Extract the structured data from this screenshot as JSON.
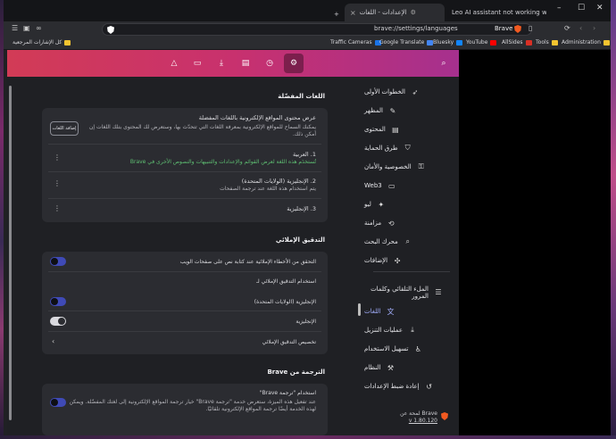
{
  "tabs": {
    "new_tab": "+",
    "active_title": "الإعدادات - اللغات",
    "other_title": "Leo AI assistant not working when B",
    "close": "×",
    "minimize": "–",
    "maximize": "☐",
    "window_close": "✕"
  },
  "toolbar": {
    "url": "brave://settings/languages",
    "brand": "Brave"
  },
  "bookmarks": [
    {
      "label": "Traffic Cameras",
      "color": "#1a73e8"
    },
    {
      "label": "Google Translate",
      "color": "#4285f4"
    },
    {
      "label": "Bluesky",
      "color": "#1185fe"
    },
    {
      "label": "YouTube",
      "color": "#ff0000"
    },
    {
      "label": "AllSides",
      "color": "#d93025"
    },
    {
      "label": "Tools",
      "color": "#f4c430"
    },
    {
      "label": "Administration",
      "color": "#f4c430"
    },
    {
      "label": "كل الإشارات المرجعية",
      "color": "#f4c430"
    }
  ],
  "sidebar": {
    "items": [
      {
        "label": "الخطوات الأولى",
        "icon": "rocket-icon"
      },
      {
        "label": "المظهر",
        "icon": "palette-icon"
      },
      {
        "label": "المحتوى",
        "icon": "content-icon"
      },
      {
        "label": "طرق الحماية",
        "icon": "shield-icon"
      },
      {
        "label": "الخصوصية والأمان",
        "icon": "lock-icon"
      },
      {
        "label": "Web3",
        "icon": "wallet-icon"
      },
      {
        "label": "ليو",
        "icon": "leo-icon"
      },
      {
        "label": "مزامنة",
        "icon": "sync-icon"
      },
      {
        "label": "محرك البحث",
        "icon": "search-icon"
      },
      {
        "label": "الإضافات",
        "icon": "extensions-icon"
      },
      {
        "label": "الملء التلقائي وكلمات المرور",
        "icon": "autofill-icon"
      },
      {
        "label": "اللغات",
        "icon": "language-icon"
      },
      {
        "label": "عمليات التنزيل",
        "icon": "download-icon"
      },
      {
        "label": "تسهيل الاستخدام",
        "icon": "accessibility-icon"
      },
      {
        "label": "النظام",
        "icon": "system-icon"
      },
      {
        "label": "إعادة ضبط الإعدادات",
        "icon": "reset-icon"
      }
    ],
    "about_label": "لمحة عن Brave",
    "version": "v 1.80.120"
  },
  "main": {
    "preferred_title": "اللغات المفضّلة",
    "preferred_heading": "عرض محتوى المواقع الإلكترونية باللغات المفضلة",
    "preferred_desc1": "يمكنك السماح للمواقع الإلكترونية بمعرفة اللغات التي تتحدّث بها، وستعرض لك المحتوى بتلك اللغات إن",
    "preferred_desc2": "أمكن ذلك.",
    "add_languages_button": "إضافة اللغات",
    "languages": [
      {
        "name": "1. العربية",
        "desc": "تُستخدَم هذه اللغة لعرض القوائم والإعدادات والتنبيهات والنصوص الأخرى في Brave",
        "desc_green": true
      },
      {
        "name": "2. الإنجليزية (الولايات المتحدة)",
        "desc": "يتم استخدام هذه اللغة عند ترجمة الصفحات",
        "desc_green": false
      },
      {
        "name": "3. الإنجليزية",
        "desc": "",
        "desc_green": false
      }
    ],
    "spell_title": "التدقيق الإملائي",
    "spell_check_label": "التحقق من الأخطاء الإملائية عند كتابة نص على صفحات الويب",
    "spell_use_label": "استخدام التدقيق الإملائي لـ",
    "spell_langs": [
      {
        "name": "الإنجليزية (الولايات المتحدة)",
        "on": true
      },
      {
        "name": "الإنجليزية",
        "on": false
      }
    ],
    "spell_customize": "تخصيص التدقيق الإملائي",
    "translate_title": "الترجمة من Brave",
    "translate_heading": "استخدام \"ترجمة Brave\"",
    "translate_desc1": "عند تفعيل هذه الميزة، ستعرض خدمة \"ترجمة Brave\" خيار ترجمة المواقع الإلكترونية إلى لغتك المفضّلة. ويمكن",
    "translate_desc2": "لهذه الخدمة أيضًا ترجمة المواقع الإلكترونية تلقائيًا."
  },
  "header_icons": [
    "rewards-icon",
    "wallet-icon",
    "download-icon",
    "bookmarks-icon",
    "history-icon",
    "settings-icon",
    "search-icon"
  ]
}
